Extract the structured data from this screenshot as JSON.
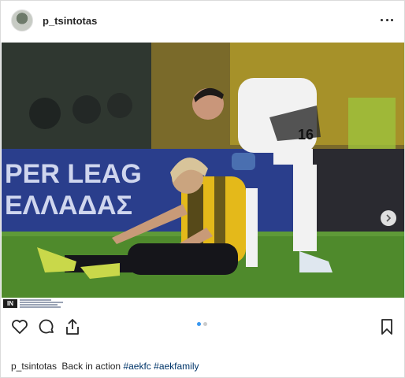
{
  "header": {
    "username": "p_tsintotas",
    "more_icon": "more-horizontal-icon"
  },
  "media": {
    "description_icon": "photo",
    "next_icon": "chevron-right-icon",
    "banner_text_top": "PER LEAG",
    "banner_text_bottom": "ΕΛΛΑΔΑΣ",
    "jersey_number": "16",
    "credit_logo": "IN"
  },
  "actions": {
    "like_icon": "heart-icon",
    "comment_icon": "comment-icon",
    "share_icon": "share-icon",
    "save_icon": "bookmark-icon"
  },
  "carousel": {
    "count": 2,
    "active_index": 0,
    "active_color": "#3897f0",
    "inactive_color": "#a8a8a8"
  },
  "caption": {
    "username": "p_tsintotas",
    "text": "Back in action",
    "hashtags": [
      "#aekfc",
      "#aekfamily"
    ],
    "hashtag_color": "#003569"
  }
}
